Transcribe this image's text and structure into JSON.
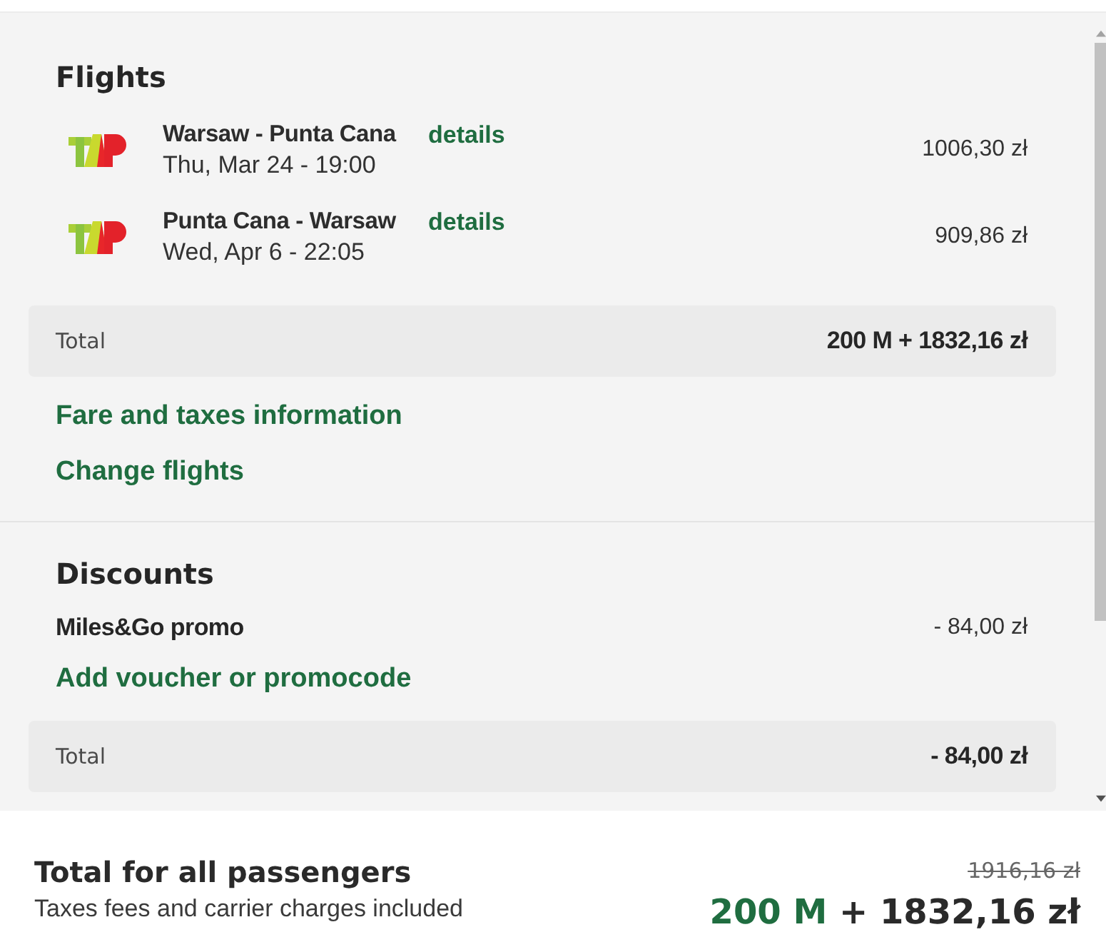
{
  "flights": {
    "title": "Flights",
    "items": [
      {
        "route": "Warsaw - Punta Cana",
        "link": "details",
        "date": "Thu, Mar 24 - 19:00",
        "price": "1006,30 zł"
      },
      {
        "route": "Punta Cana - Warsaw",
        "link": "details",
        "date": "Wed, Apr 6 - 22:05",
        "price": "909,86 zł"
      }
    ],
    "total": {
      "label": "Total",
      "value": "200 M + 1832,16 zł"
    },
    "links": [
      "Fare and taxes information",
      "Change flights"
    ]
  },
  "discounts": {
    "title": "Discounts",
    "items": [
      {
        "name": "Miles&Go promo",
        "amount": "- 84,00 zł"
      }
    ],
    "links": [
      "Add voucher or promocode"
    ],
    "total": {
      "label": "Total",
      "value": "- 84,00 zł"
    }
  },
  "footer": {
    "title": "Total for all passengers",
    "note": "Taxes fees and carrier charges included",
    "old_price": "1916,16 zł",
    "miles": "200 M",
    "price": "+ 1832,16 zł"
  }
}
